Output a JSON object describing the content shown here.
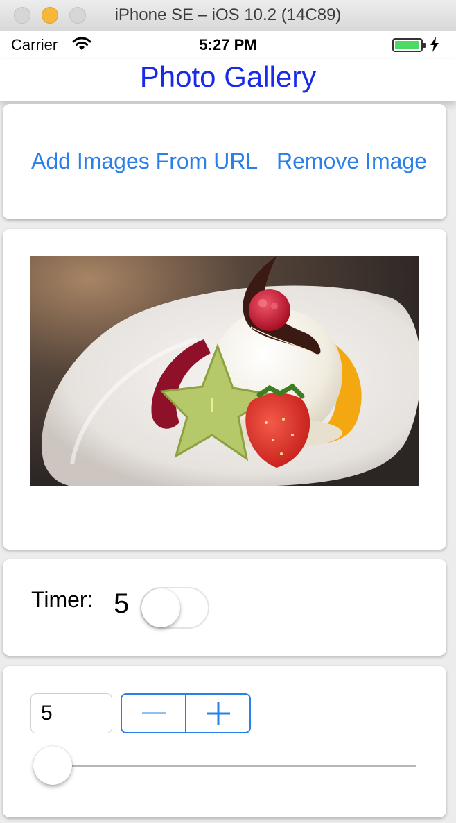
{
  "window": {
    "title": "iPhone SE – iOS 10.2 (14C89)"
  },
  "status_bar": {
    "carrier": "Carrier",
    "time": "5:27 PM"
  },
  "nav": {
    "title": "Photo Gallery"
  },
  "actions": {
    "add_label": "Add Images From URL",
    "remove_label": "Remove Image"
  },
  "timer": {
    "label": "Timer:",
    "value": "5",
    "switch_on": false
  },
  "controls": {
    "field_value": "5",
    "slider_fraction": 0.0
  },
  "colors": {
    "tint": "#2a80e8",
    "nav_title": "#1a2be8",
    "battery": "#4cd964"
  },
  "icons": [
    "wifi-icon",
    "battery-icon",
    "charging-bolt-icon",
    "minus-icon",
    "plus-icon"
  ]
}
